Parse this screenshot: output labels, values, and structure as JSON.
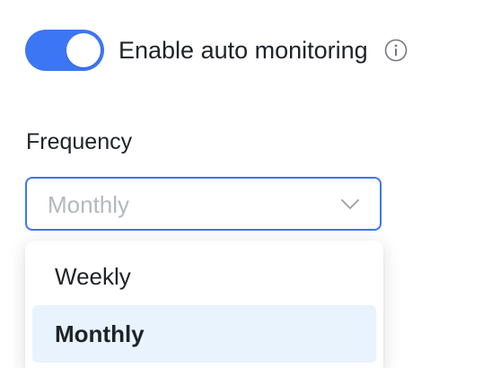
{
  "auto_monitoring": {
    "label": "Enable auto monitoring",
    "enabled": true,
    "info_icon": "info-circle-icon"
  },
  "frequency": {
    "label": "Frequency",
    "selected_value": "Monthly",
    "chevron_icon": "chevron-down-icon",
    "options": [
      {
        "label": "Weekly",
        "selected": false
      },
      {
        "label": "Monthly",
        "selected": true
      }
    ]
  },
  "colors": {
    "accent": "#3c76f4",
    "selected_option_bg": "#e8f3fe",
    "placeholder_text": "#b5b8bd"
  }
}
